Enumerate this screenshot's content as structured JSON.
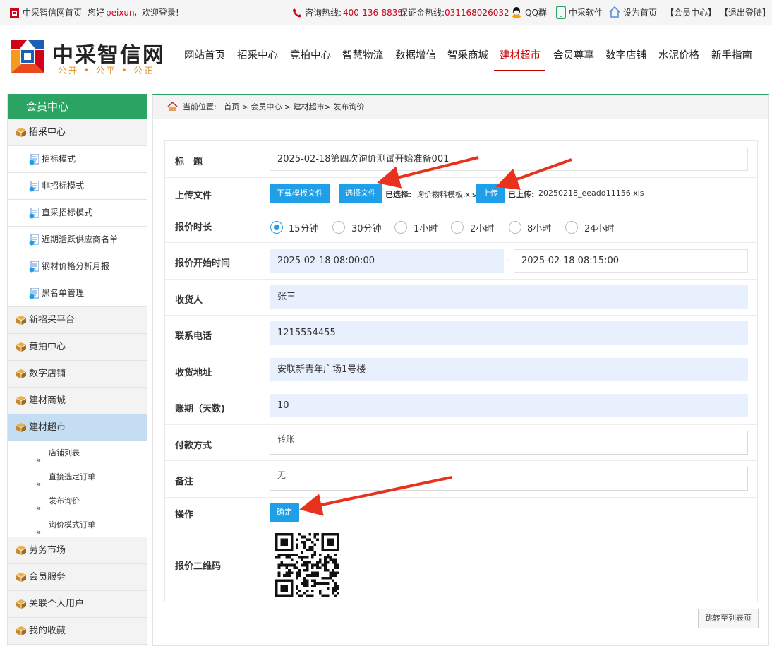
{
  "topbar": {
    "home_link": "中采智信网首页",
    "greeting_prefix": "您好",
    "username": "peixun",
    "greeting_suffix": "，欢迎登录!",
    "hotline_label": "咨询热线:",
    "hotline": "400-136-8839",
    "deposit_label": "保证金热线:",
    "deposit_phone": "031168026032",
    "qq": "QQ群",
    "software": "中采软件",
    "set_home": "设为首页",
    "member_center": "【会员中心】",
    "logout": "【退出登陆】"
  },
  "header": {
    "logo_title": "中采智信网",
    "logo_slogan": "公开 • 公平 • 公正",
    "nav": [
      "网站首页",
      "招采中心",
      "竟拍中心",
      "智慧物流",
      "数据增信",
      "智采商城",
      "建材超市",
      "会员尊享",
      "数字店铺",
      "水泥价格",
      "新手指南"
    ],
    "active_nav": "建材超市"
  },
  "sidebar": {
    "title": "会员中心",
    "cat_zhaocai": "招采中心",
    "sub_items": [
      "招标模式",
      "非招标模式",
      "直采招标模式",
      "近期活跃供应商名单",
      "钢材价格分析月报",
      "黑名单管理"
    ],
    "cats_mid": [
      "新招采平台",
      "竟拍中心",
      "数字店铺",
      "建材商城"
    ],
    "cat_active": "建材超市",
    "sub2_items": [
      "店铺列表",
      "直接选定订单",
      "发布询价",
      "询价模式订单"
    ],
    "cats_bottom": [
      "劳务市场",
      "会员服务",
      "关联个人用户",
      "我的收藏"
    ]
  },
  "breadcrumb": {
    "label": "当前位置:",
    "path": "首页 > 会员中心 > 建材超市> 发布询价"
  },
  "form": {
    "title_label": "标　题",
    "title_value": "2025-02-18第四次询价测试开始准备001",
    "upload_label": "上传文件",
    "download_template_btn": "下载模板文件",
    "choose_file_btn": "选择文件",
    "chosen_label": "已选择:",
    "chosen_file": "询价物料模板.xls",
    "upload_btn": "上传",
    "uploaded_label": "已上传:",
    "uploaded_file": "20250218_eeadd11156.xls",
    "duration_label": "报价时长",
    "duration_options": [
      "15分钟",
      "30分钟",
      "1小时",
      "2小时",
      "8小时",
      "24小时"
    ],
    "duration_selected": "15分钟",
    "start_time_label": "报价开始时间",
    "start_time": "2025-02-18 08:00:00",
    "time_sep": "-",
    "end_time": "2025-02-18 08:15:00",
    "receiver_label": "收货人",
    "receiver": "张三",
    "phone_label": "联系电话",
    "phone": "1215554455",
    "address_label": "收货地址",
    "address": "安联新青年广场1号楼",
    "term_label": "账期（天数)",
    "term": "10",
    "payment_label": "付款方式",
    "payment": "转账",
    "remark_label": "备注",
    "remark": "无",
    "action_label": "操作",
    "confirm_btn": "确定",
    "qr_label": "报价二维码"
  },
  "jump_btn": "跳转至列表页",
  "colors": {
    "accent_green": "#2ba463",
    "nav_active_red": "#c40000",
    "button_blue": "#1e9fe8",
    "annotation_red": "#e8321e"
  }
}
